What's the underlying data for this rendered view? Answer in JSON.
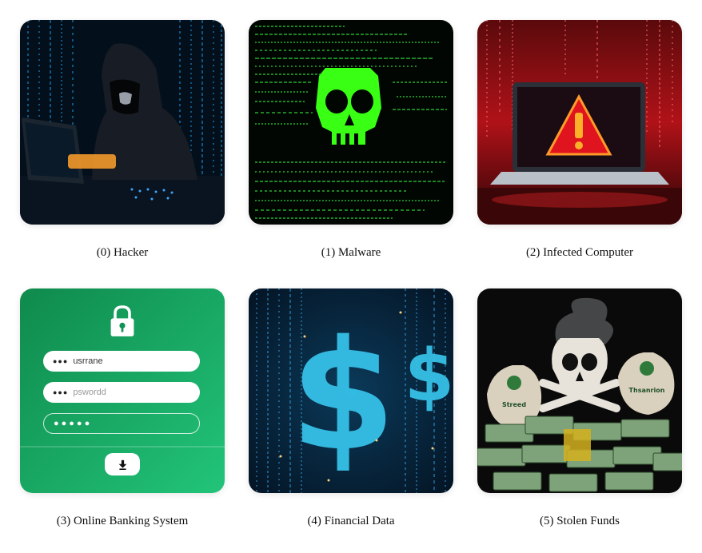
{
  "items": [
    {
      "caption": "(0) Hacker"
    },
    {
      "caption": "(1) Malware"
    },
    {
      "caption": "(2) Infected Computer"
    },
    {
      "caption": "(3) Online Banking System",
      "login": {
        "username": "usrrane",
        "password_placeholder": "pswordd"
      }
    },
    {
      "caption": "(4) Financial Data"
    },
    {
      "caption": "(5) Stolen Funds",
      "bag_labels": [
        "Streed",
        "Thsanrion"
      ]
    }
  ],
  "colors": {
    "matrix_green": "#39ff14",
    "alert_red": "#e0141e",
    "bank_green": "#1aa862",
    "data_cyan": "#38c8f0",
    "cash_green": "#6b9a6a"
  }
}
